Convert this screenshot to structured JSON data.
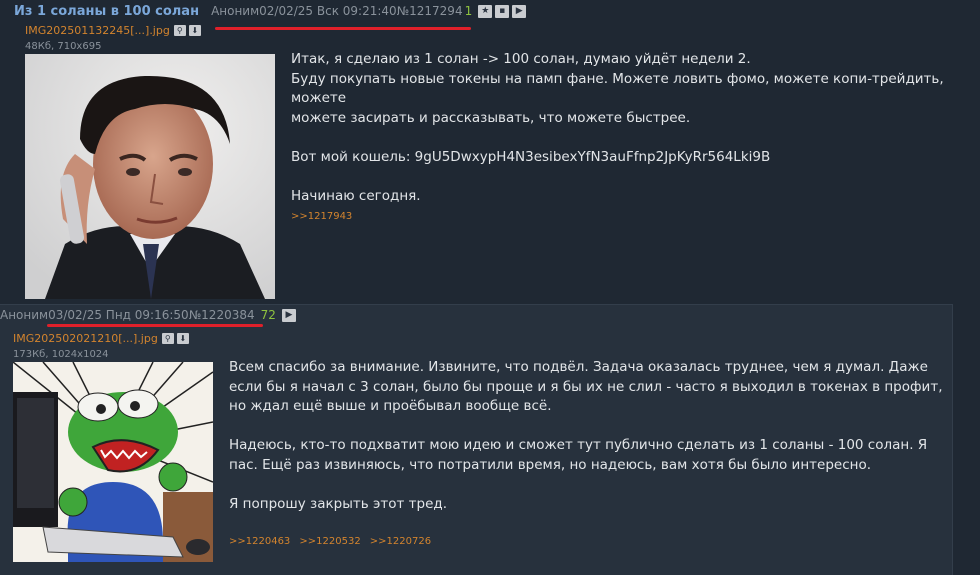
{
  "op": {
    "title": "Из 1 соланы в 100 солан",
    "author": "Аноним",
    "date": "02/02/25 Вск 09:21:40",
    "number": "№1217294",
    "count": "1",
    "file": {
      "name": "IMG202501132245[...].jpg",
      "info": "48Кб, 710x695"
    },
    "paragraphs": [
      "Итак, я сделаю из 1 солан -> 100 солан, думаю уйдёт недели 2.\nБуду покупать новые токены на памп фане. Можете ловить фомо, можете копи-трейдить, можете\nможете засирать и рассказывать, что можете быстрее.",
      "Вот мой кошель: 9gU5DwxypH4N3esibexYfN3auFfnp2JpKyRr564Lki9B",
      "Начинаю сегодня."
    ],
    "replies": [
      ">>1217943"
    ]
  },
  "reply": {
    "author": "Аноним",
    "date": "03/02/25 Пнд 09:16:50",
    "number": "№1220384",
    "count": "72",
    "file": {
      "name": "IMG202502021210[...].jpg",
      "info": "173Кб, 1024x1024"
    },
    "paragraphs": [
      "Всем спасибо за внимание. Извините, что подвёл. Задача оказалась труднее, чем я думал. Даже\nесли бы я начал с 3 солан, было бы проще и я бы их не слил - часто я выходил в токенах в профит,\nно ждал ещё выше и проёбывал вообще всё.",
      "Надеюсь, кто-то подхватит мою идею и сможет тут публично сделать из 1 соланы - 100 солан. Я\nпас. Ещё раз извиняюсь, что потратили время, но надеюсь, вам хотя бы было интересно.",
      "Я попрошу закрыть этот тред."
    ],
    "replies": [
      ">>1220463",
      ">>1220532",
      ">>1220726"
    ]
  },
  "icons": {
    "search": "search-icon",
    "download": "download-icon",
    "favorite": "star-icon",
    "menu": "menu-icon",
    "play": "play-icon"
  },
  "colors": {
    "background": "#1f2833",
    "reply_background": "#27313d",
    "title": "#7ba7d9",
    "link": "#d3842e",
    "count": "#8ec23f",
    "underline": "#e0202a"
  }
}
